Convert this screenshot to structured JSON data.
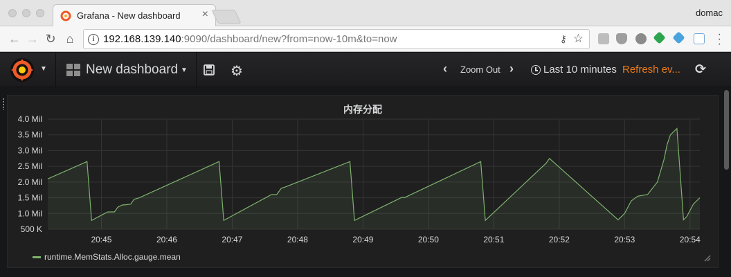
{
  "browser": {
    "tab_title": "Grafana - New dashboard",
    "tab_close": "×",
    "profile_name": "domac",
    "url_host": "192.168.139.140",
    "url_rest": ":9090/dashboard/new?from=now-10m&to=now",
    "nav_back": "←",
    "nav_forward": "→",
    "nav_reload": "↻",
    "nav_home": "⌂",
    "info_glyph": "i",
    "key_glyph": "⚷",
    "star_glyph": "☆"
  },
  "grafana": {
    "dashboard_title": "New dashboard",
    "zoom_out_label": "Zoom Out",
    "zoom_prev_glyph": "‹",
    "zoom_next_glyph": "›",
    "time_range_label": "Last 10 minutes",
    "refresh_label": "Refresh ev...",
    "refresh_glyph": "⟳",
    "settings_glyph": "⚙",
    "accent_color": "#eb7b18",
    "series_color": "#7eb26d"
  },
  "panel": {
    "title": "内存分配"
  },
  "chart_data": {
    "type": "area",
    "title": "内存分配",
    "xlabel": "",
    "ylabel": "",
    "y_tick_labels": [
      "500 K",
      "1.0 Mil",
      "1.5 Mil",
      "2.0 Mil",
      "2.5 Mil",
      "3.0 Mil",
      "3.5 Mil",
      "4.0 Mil"
    ],
    "y_ticks": [
      500000,
      1000000,
      1500000,
      2000000,
      2500000,
      3000000,
      3500000,
      4000000
    ],
    "ylim": [
      500000,
      4000000
    ],
    "x_tick_labels": [
      "20:45",
      "20:46",
      "20:47",
      "20:48",
      "20:49",
      "20:50",
      "20:51",
      "20:52",
      "20:53",
      "20:54"
    ],
    "x_ticks_min": [
      0,
      1,
      2,
      3,
      4,
      5,
      6,
      7,
      8,
      9
    ],
    "xlim_min": [
      -0.82,
      9.15
    ],
    "grid": true,
    "legend_position": "bottom-left",
    "series": [
      {
        "name": "runtime.MemStats.Alloc.gauge.mean",
        "x": [
          -0.82,
          -0.22,
          -0.15,
          0.05,
          0.1,
          0.2,
          0.25,
          0.32,
          0.38,
          0.45,
          0.5,
          0.58,
          1.8,
          1.87,
          2.6,
          2.68,
          2.75,
          2.82,
          3.8,
          3.87,
          4.6,
          4.63,
          5.8,
          5.87,
          6.8,
          6.85,
          7.9,
          7.95,
          8.0,
          8.1,
          8.2,
          8.35,
          8.5,
          8.6,
          8.65,
          8.7,
          8.8,
          8.9,
          8.95,
          9.05,
          9.15
        ],
        "y": [
          2100000,
          2650000,
          780000,
          1000000,
          1050000,
          1050000,
          1200000,
          1270000,
          1280000,
          1300000,
          1450000,
          1500000,
          2650000,
          780000,
          1600000,
          1600000,
          1800000,
          1850000,
          2650000,
          780000,
          1520000,
          1500000,
          2650000,
          780000,
          2600000,
          2750000,
          800000,
          900000,
          1000000,
          1400000,
          1550000,
          1600000,
          2000000,
          2700000,
          3200000,
          3500000,
          3700000,
          800000,
          900000,
          1300000,
          1500000
        ]
      }
    ]
  }
}
